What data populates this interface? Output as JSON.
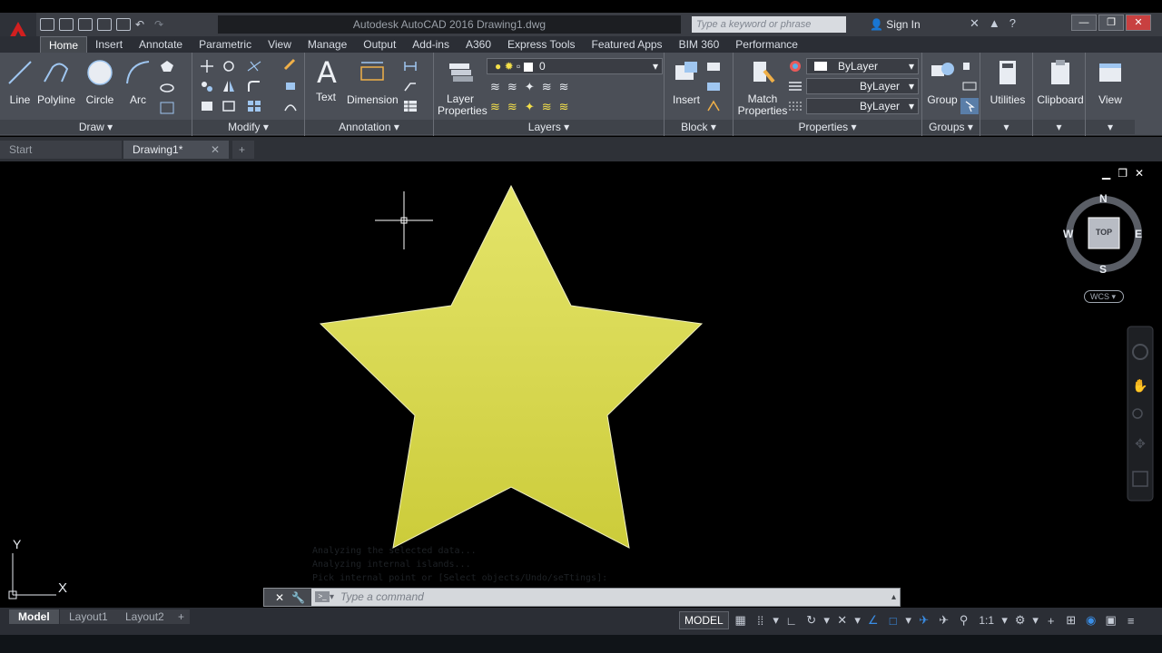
{
  "title_bar": {
    "window_title": "Autodesk AutoCAD 2016    Drawing1.dwg",
    "search_placeholder": "Type a keyword or phrase",
    "sign_in": "Sign In"
  },
  "ribbon_tabs": [
    "Home",
    "Insert",
    "Annotate",
    "Parametric",
    "View",
    "Manage",
    "Output",
    "Add-ins",
    "A360",
    "Express Tools",
    "Featured Apps",
    "BIM 360",
    "Performance"
  ],
  "panels": {
    "draw": {
      "title": "Draw",
      "tools": [
        "Line",
        "Polyline",
        "Circle",
        "Arc"
      ]
    },
    "modify": {
      "title": "Modify"
    },
    "annotation": {
      "title": "Annotation",
      "tools": [
        "Text",
        "Dimension"
      ]
    },
    "layers": {
      "title": "Layers",
      "layer_properties": "Layer\nProperties",
      "current_layer": "0"
    },
    "block": {
      "title": "Block",
      "insert": "Insert"
    },
    "properties": {
      "title": "Properties",
      "match": "Match\nProperties",
      "color": "ByLayer",
      "linetype": "ByLayer",
      "lineweight": "ByLayer"
    },
    "groups": {
      "title": "Groups",
      "group": "Group"
    },
    "utilities": {
      "label": "Utilities"
    },
    "clipboard": {
      "label": "Clipboard"
    },
    "view": {
      "label": "View"
    }
  },
  "doc_tabs": [
    "Start",
    "Drawing1*"
  ],
  "viewcube": {
    "north": "N",
    "south": "S",
    "east": "E",
    "west": "W",
    "face": "TOP",
    "wcs": "WCS"
  },
  "ucs": {
    "y": "Y",
    "x": "X"
  },
  "command": {
    "history": [
      "Analyzing the selected data...",
      "Analyzing internal islands...",
      "Pick internal point or [Select objects/Undo/seTtings]:"
    ],
    "placeholder": "Type  a  command"
  },
  "layouts": [
    "Model",
    "Layout1",
    "Layout2"
  ],
  "status": {
    "model": "MODEL",
    "scale": "1:1"
  },
  "colors": {
    "star_fill": "#d6d64a",
    "ribbon_bg": "#4b4f57",
    "canvas_bg": "#000000"
  }
}
